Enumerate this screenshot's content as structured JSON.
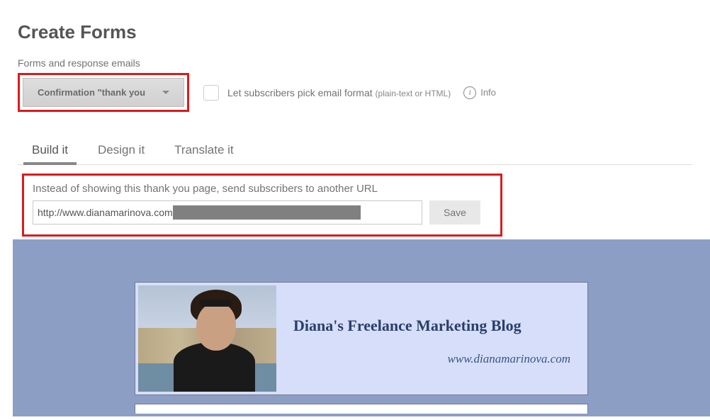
{
  "page_title": "Create Forms",
  "forms_label": "Forms and response emails",
  "dropdown_selected": "Confirmation \"thank you",
  "checkbox": {
    "label": "Let subscribers pick email format",
    "hint": "(plain-text or HTML)"
  },
  "info_label": "Info",
  "tabs": [
    {
      "label": "Build it",
      "active": true
    },
    {
      "label": "Design it",
      "active": false
    },
    {
      "label": "Translate it",
      "active": false
    }
  ],
  "redirect": {
    "label": "Instead of showing this thank you page, send subscribers to another URL",
    "url_visible": "http://www.dianamarinova.com",
    "save_label": "Save"
  },
  "preview_banner": {
    "title": "Diana's Freelance Marketing Blog",
    "url": "www.dianamarinova.com"
  }
}
